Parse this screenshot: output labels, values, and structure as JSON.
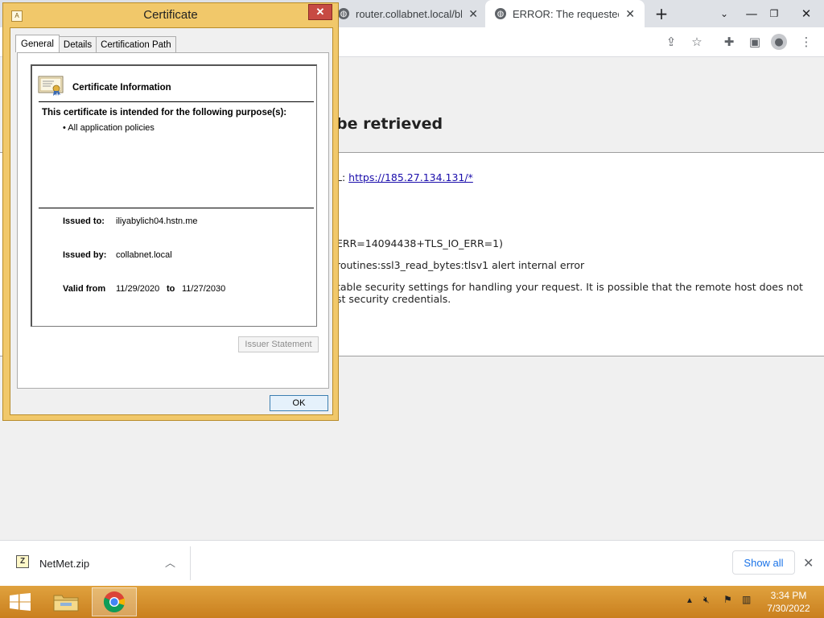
{
  "browser": {
    "tabs": [
      {
        "title": "router.collabnet.local/blo",
        "active": false,
        "icon": "globe-icon"
      },
      {
        "title": "ERROR: The requested U",
        "active": true,
        "icon": "globe-icon"
      }
    ],
    "new_tab_icon": "plus-icon",
    "toolbar_icons": [
      "share-icon",
      "star-icon",
      "extensions-icon",
      "side-panel-icon",
      "profile-icon",
      "menu-icon"
    ]
  },
  "page": {
    "title_fragment": "be retrieved",
    "url_prefix": "L:",
    "url": "https://185.27.134.131/*",
    "err_line": "ERR=14094438+TLS_IO_ERR=1)",
    "routine_line": "routines:ssl3_read_bytes:tlsv1 alert internal error",
    "desc_line1": "table security settings for handling your request. It is possible that the remote host does not",
    "desc_line2": "st security credentials."
  },
  "dialog": {
    "title": "Certificate",
    "close": "✕",
    "tabs": [
      "General",
      "Details",
      "Certification Path"
    ],
    "selected_tab": "General",
    "heading": "Certificate Information",
    "purpose_heading": "This certificate is intended for the following purpose(s):",
    "purpose_items": [
      "• All application policies"
    ],
    "issued_to_label": "Issued to:",
    "issued_to": "iliyabylich04.hstn.me",
    "issued_by_label": "Issued by:",
    "issued_by": "collabnet.local",
    "valid_from_label": "Valid from",
    "valid_from": "11/29/2020",
    "valid_to_label": "to",
    "valid_to": "11/27/2030",
    "issuer_statement": "Issuer Statement",
    "ok": "OK"
  },
  "downloads": {
    "file": "NetMet.zip",
    "show_all": "Show all"
  },
  "taskbar": {
    "time": "3:34 PM",
    "date": "7/30/2022"
  }
}
